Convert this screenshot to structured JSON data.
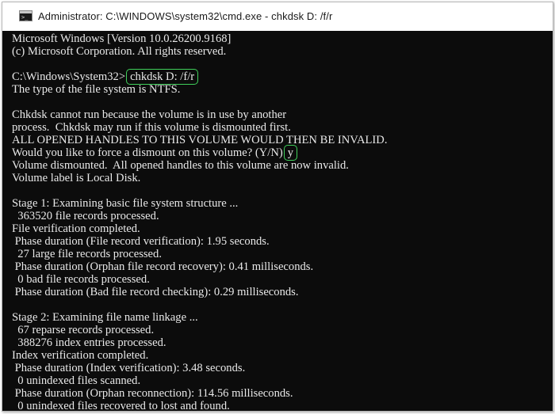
{
  "window": {
    "title": "Administrator: C:\\WINDOWS\\system32\\cmd.exe - chkdsk  D: /f/r"
  },
  "console": {
    "lines": [
      "Microsoft Windows [Version 10.0.26200.9168]",
      "(c) Microsoft Corporation. All rights reserved.",
      "",
      "C:\\Windows\\System32>",
      "The type of the file system is NTFS.",
      "",
      "Chkdsk cannot run because the volume is in use by another",
      "process.  Chkdsk may run if this volume is dismounted first.",
      "ALL OPENED HANDLES TO THIS VOLUME WOULD THEN BE INVALID.",
      "Would you like to force a dismount on this volume? (Y/N)",
      "Volume dismounted.  All opened handles to this volume are now invalid.",
      "Volume label is Local Disk.",
      "",
      "Stage 1: Examining basic file system structure ...",
      "  363520 file records processed.",
      "File verification completed.",
      " Phase duration (File record verification): 1.95 seconds.",
      "  27 large file records processed.",
      " Phase duration (Orphan file record recovery): 0.41 milliseconds.",
      "  0 bad file records processed.",
      " Phase duration (Bad file record checking): 0.29 milliseconds.",
      "",
      "Stage 2: Examining file name linkage ...",
      "  67 reparse records processed.",
      "  388276 index entries processed.",
      "Index verification completed.",
      " Phase duration (Index verification): 3.48 seconds.",
      "  0 unindexed files scanned.",
      " Phase duration (Orphan reconnection): 114.56 milliseconds.",
      "  0 unindexed files recovered to lost and found."
    ],
    "typed_command": "chkdsk D: /f/r",
    "typed_answer": "y"
  },
  "colors": {
    "highlight": "#3fcf5a",
    "console_bg": "#0c0c0c",
    "console_text": "#e9e9e9"
  }
}
